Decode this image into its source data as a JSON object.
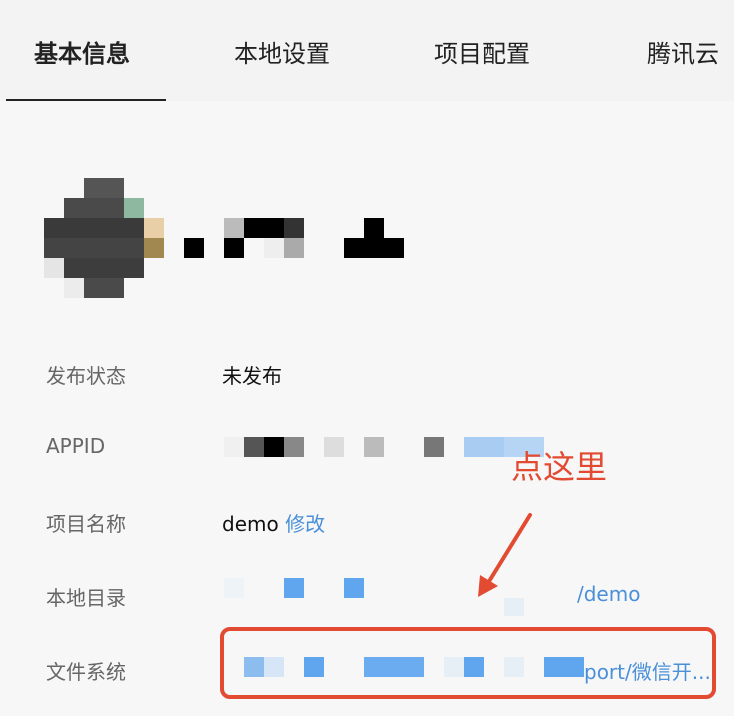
{
  "tabs": [
    {
      "label": "基本信息",
      "active": true
    },
    {
      "label": "本地设置",
      "active": false
    },
    {
      "label": "项目配置",
      "active": false
    },
    {
      "label": "腾讯云",
      "active": false
    }
  ],
  "info": {
    "publish_status": {
      "label": "发布状态",
      "value": "未发布"
    },
    "appid": {
      "label": "APPID"
    },
    "project_name": {
      "label": "项目名称",
      "value": "demo",
      "action": "修改"
    },
    "local_dir": {
      "label": "本地目录",
      "value_suffix": "/demo"
    },
    "file_system": {
      "label": "文件系统",
      "value_suffix": "port/微信开..."
    }
  },
  "annotation": {
    "text": "点这里",
    "color": "#e24a32"
  },
  "colors": {
    "link": "#4a90d9",
    "annotation": "#e24a32"
  }
}
